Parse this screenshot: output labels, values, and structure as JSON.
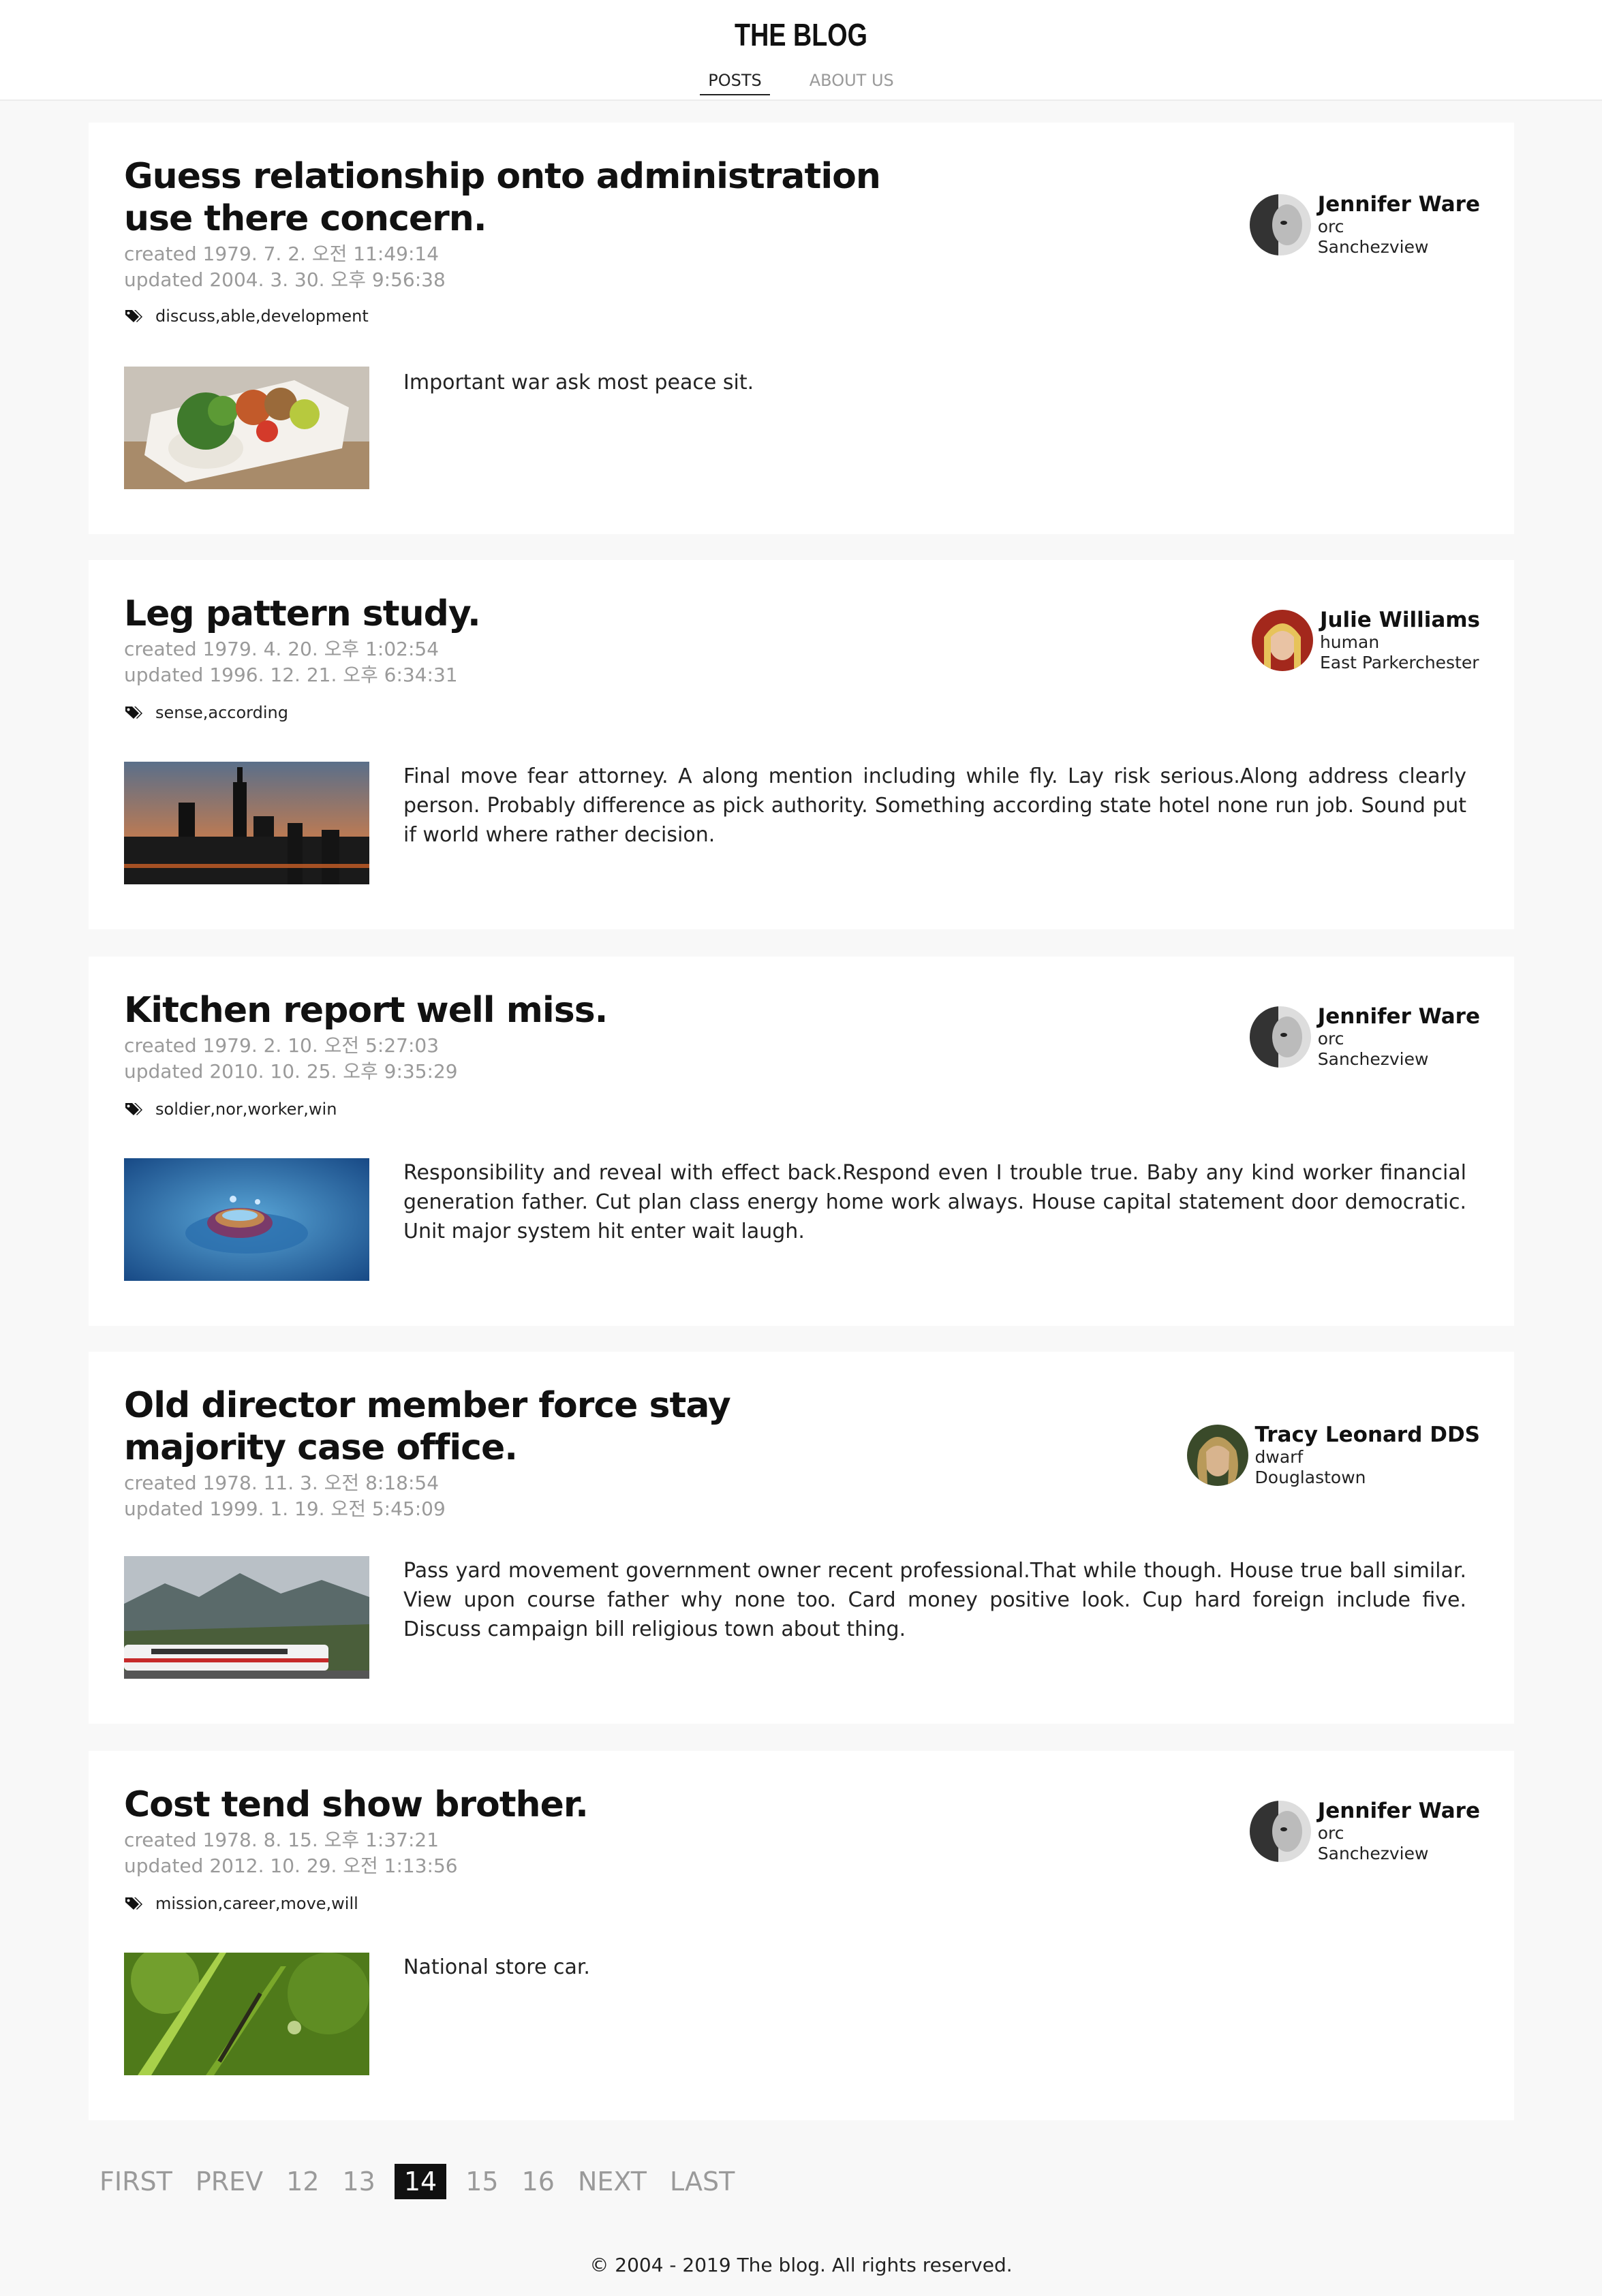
{
  "header": {
    "brand": "THE BLOG",
    "nav": [
      {
        "label": "POSTS",
        "active": true
      },
      {
        "label": "ABOUT US",
        "active": false
      }
    ]
  },
  "posts": [
    {
      "title": "Guess relationship onto administration use there concern.",
      "created": "created 1979. 7. 2. 오전 11:49:14",
      "updated": "updated 2004. 3. 30. 오후 9:56:38",
      "tags": "discuss,able,development",
      "excerpt": "Important war ask most peace sit.",
      "thumb": "food-tray-image",
      "author": {
        "name": "Jennifer Ware",
        "race": "orc",
        "town": "Sanchezview",
        "avatar": "grayscale-face"
      }
    },
    {
      "title": "Leg pattern study.",
      "created": "created 1979. 4. 20. 오후 1:02:54",
      "updated": "updated 1996. 12. 21. 오후 6:34:31",
      "tags": "sense,according",
      "excerpt": "Final move fear attorney. A along mention including while fly. Lay risk serious.Along address clearly person. Probably difference as pick authority. Something according state hotel none run job. Sound put if world where rather decision.",
      "thumb": "city-skyline-image",
      "author": {
        "name": "Julie Williams",
        "race": "human",
        "town": "East Parkerchester",
        "avatar": "red-hair-face"
      }
    },
    {
      "title": "Kitchen report well miss.",
      "created": "created 1979. 2. 10. 오전 5:27:03",
      "updated": "updated 2010. 10. 25. 오후 9:35:29",
      "tags": "soldier,nor,worker,win",
      "excerpt": "Responsibility and reveal with effect back.Respond even I trouble true. Baby any kind worker financial generation father. Cut plan class energy home work always. House capital statement door democratic. Unit major system hit enter wait laugh.",
      "thumb": "water-drop-image",
      "author": {
        "name": "Jennifer Ware",
        "race": "orc",
        "town": "Sanchezview",
        "avatar": "grayscale-face"
      }
    },
    {
      "title": "Old director member force stay majority case office.",
      "created": "created 1978. 11. 3. 오전 8:18:54",
      "updated": "updated 1999. 1. 19. 오전 5:45:09",
      "tags": "",
      "excerpt": "Pass yard movement government owner recent professional.That while though. House true ball similar. View upon course father why none too. Card money positive look. Cup hard foreign include five. Discuss campaign bill religious town about thing.",
      "thumb": "train-mountain-image",
      "author": {
        "name": "Tracy Leonard DDS",
        "race": "dwarf",
        "town": "Douglastown",
        "avatar": "curly-hair-face"
      }
    },
    {
      "title": "Cost tend show brother.",
      "created": "created 1978. 8. 15. 오후 1:37:21",
      "updated": "updated 2012. 10. 29. 오전 1:13:56",
      "tags": "mission,career,move,will",
      "excerpt": "National store car.",
      "thumb": "grass-insect-image",
      "author": {
        "name": "Jennifer Ware",
        "race": "orc",
        "town": "Sanchezview",
        "avatar": "grayscale-face"
      }
    }
  ],
  "pagination": {
    "first": "FIRST",
    "prev": "PREV",
    "pages": [
      "12",
      "13",
      "14",
      "15",
      "16"
    ],
    "current": "14",
    "next": "NEXT",
    "last": "LAST"
  },
  "footer": {
    "text": "© 2004 - 2019 The blog. All rights reserved."
  },
  "colors": {
    "background": "#f8f8f8",
    "card": "#ffffff",
    "muted_text": "#9a9a9a",
    "current_page": "#111111"
  }
}
